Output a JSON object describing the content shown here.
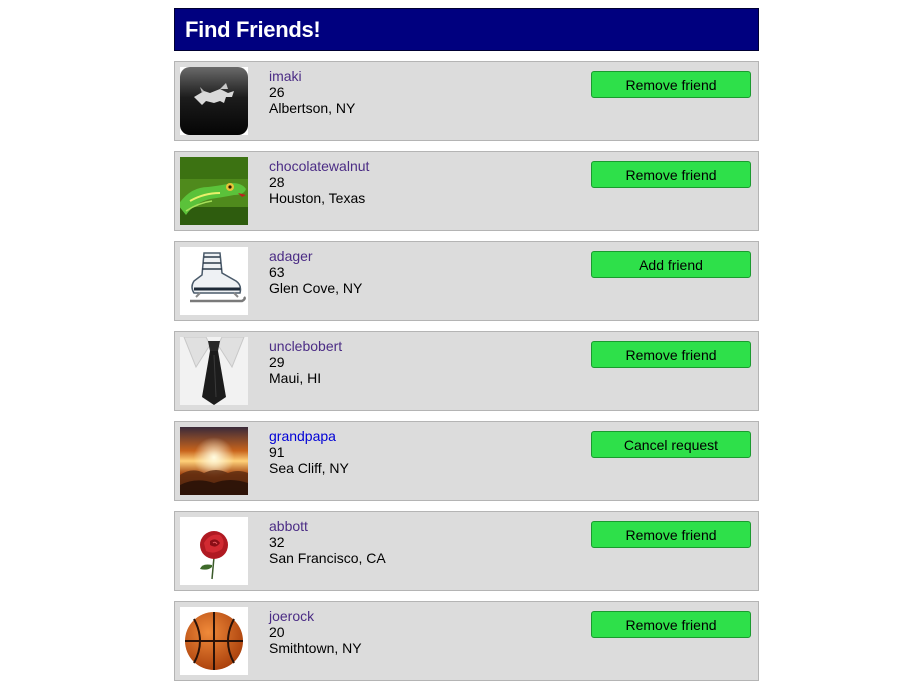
{
  "header": {
    "title": "Find Friends!"
  },
  "colors": {
    "header_bg": "#00007f",
    "row_bg": "#dcdcdc",
    "button_green": "#2ee04a",
    "link_visited": "#4b2c85",
    "link_pending": "#0000d6"
  },
  "friends": [
    {
      "username": "imaki",
      "age": "26",
      "location": "Albertson, NY",
      "action": "Remove friend",
      "avatar": "mustang-logo-icon"
    },
    {
      "username": "chocolatewalnut",
      "age": "28",
      "location": "Houston, Texas",
      "action": "Remove friend",
      "avatar": "green-snake-icon"
    },
    {
      "username": "adager",
      "age": "63",
      "location": "Glen Cove, NY",
      "action": "Add friend",
      "avatar": "ice-skate-icon"
    },
    {
      "username": "unclebobert",
      "age": "29",
      "location": "Maui, HI",
      "action": "Remove friend",
      "avatar": "necktie-icon"
    },
    {
      "username": "grandpapa",
      "age": "91",
      "location": "Sea Cliff, NY",
      "action": "Cancel request",
      "avatar": "sunset-icon"
    },
    {
      "username": "abbott",
      "age": "32",
      "location": "San Francisco, CA",
      "action": "Remove friend",
      "avatar": "rose-icon"
    },
    {
      "username": "joerock",
      "age": "20",
      "location": "Smithtown, NY",
      "action": "Remove friend",
      "avatar": "basketball-icon"
    }
  ]
}
